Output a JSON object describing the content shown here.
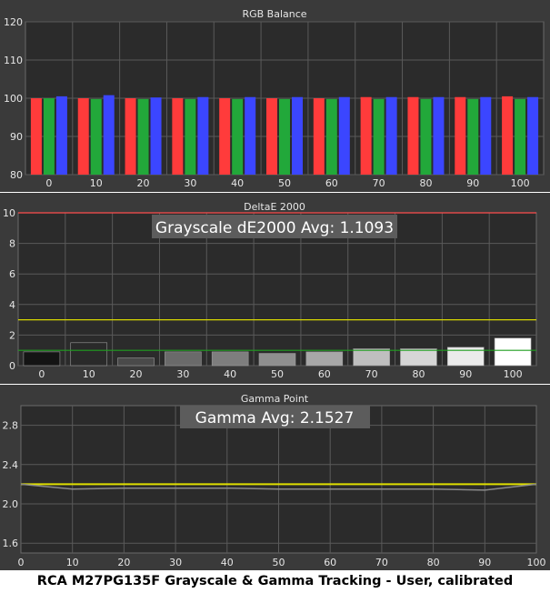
{
  "caption": "RCA M27PG135F Grayscale & Gamma Tracking - User, calibrated",
  "colors": {
    "background": "#3a3a3a",
    "plot_background": "#2b2b2b",
    "grid": "#5a5a5a",
    "text": "#e6e6e6",
    "red": "#ff3b3b",
    "green": "#22a83a",
    "blue": "#3b46ff",
    "delta_limit_line": "#ff4d4d",
    "delta_warning_line": "#d8d800",
    "delta_good_line": "#1f9e1f",
    "gamma_target_line": "#e0e000",
    "gamma_measured_line": "#8a8a8a",
    "annotation_box": "#5c5c5c"
  },
  "chart_data": [
    {
      "type": "bar",
      "title": "RGB Balance",
      "categories": [
        "0",
        "10",
        "20",
        "30",
        "40",
        "50",
        "60",
        "70",
        "80",
        "90",
        "100"
      ],
      "ylim": [
        80,
        120
      ],
      "yticks": [
        80,
        90,
        100,
        110,
        120
      ],
      "grid": true,
      "series": [
        {
          "color": "red",
          "values": [
            100,
            100,
            100,
            100,
            100,
            100,
            100,
            100.3,
            100.3,
            100.3,
            100.5
          ]
        },
        {
          "color": "green",
          "values": [
            100,
            99.8,
            99.8,
            99.8,
            99.8,
            99.8,
            99.8,
            99.8,
            99.8,
            99.8,
            99.8
          ]
        },
        {
          "color": "blue",
          "values": [
            100.5,
            100.8,
            100.2,
            100.3,
            100.3,
            100.3,
            100.3,
            100.3,
            100.3,
            100.3,
            100.3
          ]
        }
      ]
    },
    {
      "type": "bar",
      "title": "DeltaE 2000",
      "annotation": "Grayscale dE2000 Avg: 1.1093",
      "categories": [
        "0",
        "10",
        "20",
        "30",
        "40",
        "50",
        "60",
        "70",
        "80",
        "90",
        "100"
      ],
      "values": [
        0.9,
        1.5,
        0.5,
        0.9,
        0.9,
        0.8,
        0.9,
        1.1,
        1.1,
        1.2,
        1.8
      ],
      "bar_colors": [
        "#141414",
        "#2a2a2a",
        "#4a4a4a",
        "#6a6a6a",
        "#7e7e7e",
        "#8f8f8f",
        "#a7a7a7",
        "#bfbfbf",
        "#d6d6d6",
        "#ebebeb",
        "#ffffff"
      ],
      "reference_lines": [
        10,
        3,
        1
      ],
      "ylim": [
        0,
        10
      ],
      "yticks": [
        0,
        2,
        4,
        6,
        8,
        10
      ],
      "grid": true
    },
    {
      "type": "line",
      "title": "Gamma Point",
      "annotation": "Gamma Avg: 2.1527",
      "x": [
        0,
        10,
        20,
        30,
        40,
        50,
        60,
        70,
        80,
        90,
        100
      ],
      "xticks": [
        0,
        10,
        20,
        30,
        40,
        50,
        60,
        70,
        80,
        90,
        100
      ],
      "target": 2.2,
      "measured": [
        2.2,
        2.15,
        2.16,
        2.16,
        2.16,
        2.15,
        2.15,
        2.15,
        2.15,
        2.14,
        2.2
      ],
      "ylim": [
        1.5,
        3.0
      ],
      "yticks": [
        1.6,
        2.0,
        2.4,
        2.8
      ],
      "grid": true
    }
  ]
}
